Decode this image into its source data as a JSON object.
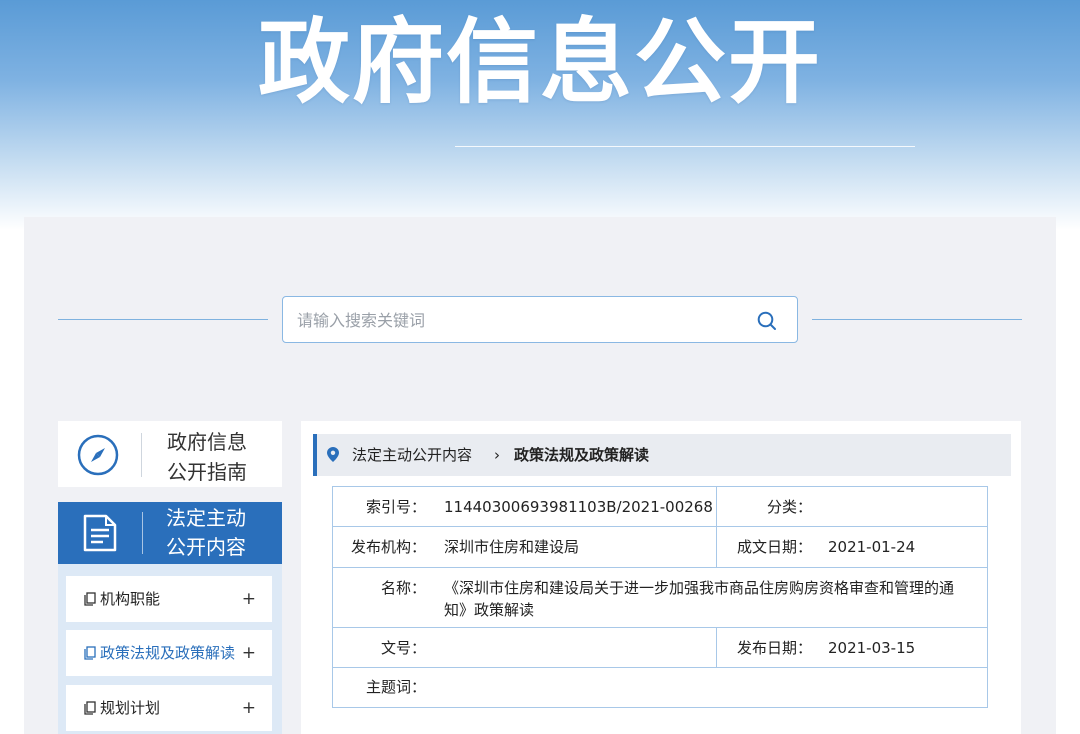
{
  "hero": {
    "title": "政府信息公开"
  },
  "search": {
    "placeholder": "请输入搜索关键词"
  },
  "sidebar": {
    "guide": {
      "label": "政府信息\n公开指南"
    },
    "legal": {
      "label": "法定主动\n公开内容"
    },
    "items": [
      {
        "label": "机构职能",
        "expand": "+"
      },
      {
        "label": "政策法规及政策解读",
        "expand": "+",
        "active": true
      },
      {
        "label": "规划计划",
        "expand": "+"
      }
    ]
  },
  "breadcrumb": {
    "parent": "法定主动公开内容",
    "separator": "›",
    "current": "政策法规及政策解读"
  },
  "meta": {
    "index_label": "索引号：",
    "index_value": "11440300693981103B/2021-00268",
    "category_label": "分类：",
    "category_value": "",
    "org_label": "发布机构：",
    "org_value": "深圳市住房和建设局",
    "created_label": "成文日期：",
    "created_value": "2021-01-24",
    "name_label": "名称：",
    "name_value": "《深圳市住房和建设局关于进一步加强我市商品住房购房资格审查和管理的通知》政策解读",
    "docno_label": "文号：",
    "docno_value": "",
    "pubdate_label": "发布日期：",
    "pubdate_value": "2021-03-15",
    "keywords_label": "主题词：",
    "keywords_value": ""
  },
  "colors": {
    "accent": "#2a6fbb",
    "hero_top": "#5a9bd6",
    "border": "#a8c8e8",
    "panel_bg": "#f0f1f5"
  }
}
